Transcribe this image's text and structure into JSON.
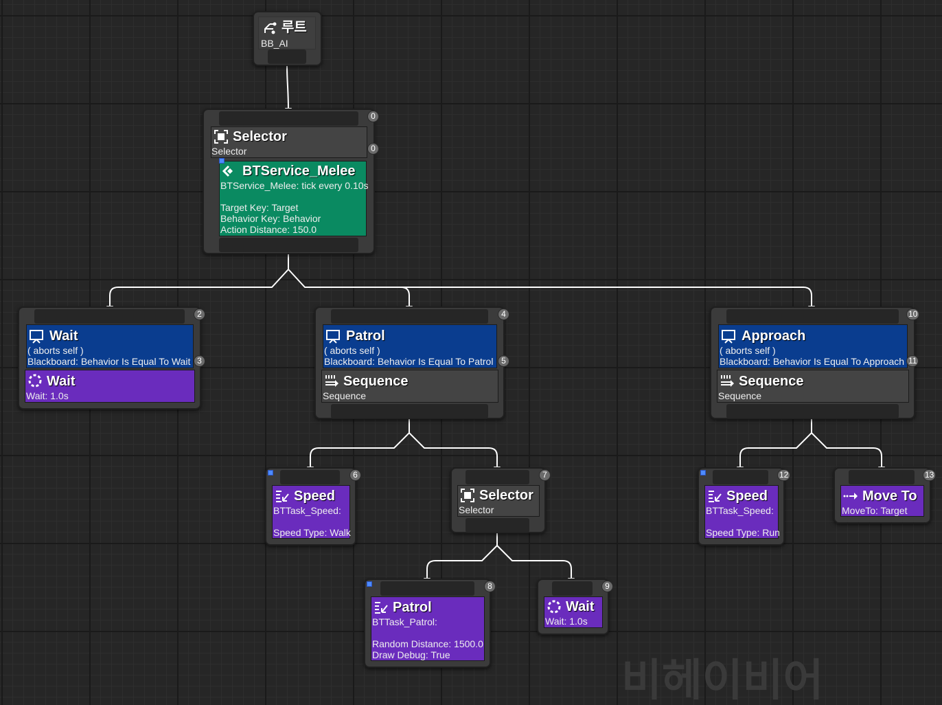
{
  "root": {
    "title": "루트",
    "subtitle": "BB_AI"
  },
  "selector_main": {
    "title": "Selector",
    "subtitle": "Selector",
    "index": "0",
    "composite_index": "0"
  },
  "service_melee": {
    "title": "BTService_Melee",
    "desc": "BTService_Melee: tick every 0.10s",
    "lines": [
      "Target Key: Target",
      "Behavior Key: Behavior",
      "Action Distance: 150.0"
    ]
  },
  "wait_branch": {
    "decorator_title": "Wait",
    "aborts": "( aborts self )",
    "condition": "Blackboard: Behavior Is Equal To Wait",
    "index": "2",
    "decorator_index": "3",
    "task_title": "Wait",
    "task_desc": "Wait: 1.0s"
  },
  "patrol_branch": {
    "decorator_title": "Patrol",
    "aborts": "( aborts self )",
    "condition": "Blackboard: Behavior Is Equal To Patrol",
    "index": "4",
    "decorator_index": "5",
    "composite_title": "Sequence",
    "composite_sub": "Sequence"
  },
  "approach_branch": {
    "decorator_title": "Approach",
    "aborts": "( aborts self )",
    "condition": "Blackboard: Behavior Is Equal To Approach",
    "index": "10",
    "decorator_index": "11",
    "composite_title": "Sequence",
    "composite_sub": "Sequence"
  },
  "speed_walk": {
    "title": "Speed",
    "desc": "BTTask_Speed:",
    "param": "Speed Type: Walk",
    "index": "6"
  },
  "selector_sub": {
    "title": "Selector",
    "subtitle": "Selector",
    "index": "7"
  },
  "patrol_task": {
    "title": "Patrol",
    "desc": "BTTask_Patrol:",
    "lines": [
      "Random Distance: 1500.0",
      "Draw Debug: True"
    ],
    "index": "8"
  },
  "wait_task": {
    "title": "Wait",
    "desc": "Wait: 1.0s",
    "index": "9"
  },
  "speed_run": {
    "title": "Speed",
    "desc": "BTTask_Speed:",
    "param": "Speed Type: Run",
    "index": "12"
  },
  "move_to": {
    "title": "Move To",
    "desc": "MoveTo: Target",
    "index": "13"
  },
  "watermark": "비헤이비어",
  "colors": {
    "background": "#262626",
    "wire": "#ffffff",
    "decorator": "#0a3d8f",
    "task": "#6a2cbd",
    "service": "#0a8a61",
    "composite": "#444444",
    "badge": "#6b6b6b"
  },
  "icons": {
    "root": "root-icon",
    "selector": "selector-icon",
    "service": "service-icon",
    "decorator": "decorator-icon",
    "wait": "wait-icon",
    "sequence": "sequence-icon",
    "task": "task-icon",
    "move_to": "move-to-icon"
  }
}
